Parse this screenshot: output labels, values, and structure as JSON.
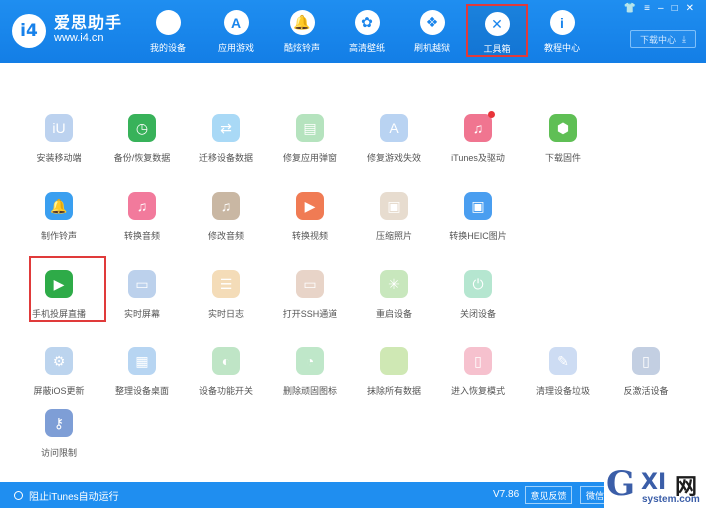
{
  "app": {
    "logo_mark": "i4",
    "name": "爱思助手",
    "url": "www.i4.cn"
  },
  "nav": [
    {
      "label": "我的设备",
      "icon": "apple-icon",
      "glyph": ""
    },
    {
      "label": "应用游戏",
      "icon": "app-store-icon",
      "glyph": "A"
    },
    {
      "label": "酷炫铃声",
      "icon": "bell-icon",
      "glyph": "🔔"
    },
    {
      "label": "高清壁纸",
      "icon": "flower-icon",
      "glyph": "✿"
    },
    {
      "label": "刷机越狱",
      "icon": "dropbox-icon",
      "glyph": "❖"
    },
    {
      "label": "工具箱",
      "icon": "tools-icon",
      "glyph": "✕",
      "active": true
    },
    {
      "label": "教程中心",
      "icon": "info-icon",
      "glyph": "i"
    }
  ],
  "window_controls": [
    "👕",
    "≡",
    "–",
    "□",
    "✕"
  ],
  "download_center": {
    "label": "下载中心",
    "icon": "download-icon",
    "glyph": "⤓"
  },
  "tools": [
    [
      {
        "label": "安装移动端",
        "icon": "i4-app-icon",
        "glyph": "iU",
        "color": "#bcd2ef"
      },
      {
        "label": "备份/恢复数据",
        "icon": "backup-clock-icon",
        "glyph": "◷",
        "color": "#38b25a"
      },
      {
        "label": "迁移设备数据",
        "icon": "migrate-icon",
        "glyph": "⇄",
        "color": "#a9d9f6"
      },
      {
        "label": "修复应用弹窗",
        "icon": "repair-popup-icon",
        "glyph": "▤",
        "color": "#b5e3be"
      },
      {
        "label": "修复游戏失效",
        "icon": "repair-game-icon",
        "glyph": "A",
        "color": "#b9d3f2"
      },
      {
        "label": "iTunes及驱动",
        "icon": "itunes-icon",
        "glyph": "♫",
        "color": "#f07590",
        "badge": true
      },
      {
        "label": "下载固件",
        "icon": "firmware-box-icon",
        "glyph": "⬢",
        "color": "#5fbf55"
      }
    ],
    [
      {
        "label": "制作铃声",
        "icon": "ringtone-bell-icon",
        "glyph": "🔔",
        "color": "#3a9ff0"
      },
      {
        "label": "转换音频",
        "icon": "audio-convert-icon",
        "glyph": "♫",
        "color": "#f27a9c"
      },
      {
        "label": "修改音频",
        "icon": "audio-edit-icon",
        "glyph": "♫",
        "color": "#c9b7a3"
      },
      {
        "label": "转换视频",
        "icon": "video-convert-icon",
        "glyph": "▶",
        "color": "#f07b54"
      },
      {
        "label": "压缩照片",
        "icon": "compress-photo-icon",
        "glyph": "▣",
        "color": "#e7dccf"
      },
      {
        "label": "转换HEIC图片",
        "icon": "heic-convert-icon",
        "glyph": "▣",
        "color": "#4a9ef0"
      }
    ],
    [
      {
        "label": "手机投屏直播",
        "icon": "screen-mirror-icon",
        "glyph": "▶",
        "color": "#2eab48"
      },
      {
        "label": "实时屏幕",
        "icon": "realtime-screen-icon",
        "glyph": "▭",
        "color": "#bcd1ec"
      },
      {
        "label": "实时日志",
        "icon": "realtime-log-icon",
        "glyph": "☰",
        "color": "#f4dcb8"
      },
      {
        "label": "打开SSH通道",
        "icon": "ssh-terminal-icon",
        "glyph": "▭",
        "color": "#e8d4c8"
      },
      {
        "label": "重启设备",
        "icon": "restart-icon",
        "glyph": "✳",
        "color": "#c8e7bd"
      },
      {
        "label": "关闭设备",
        "icon": "power-icon",
        "glyph": "⏻",
        "color": "#b5e6d0"
      }
    ],
    [
      {
        "label": "屏蔽iOS更新",
        "icon": "block-update-icon",
        "glyph": "⚙",
        "color": "#bcd4ee"
      },
      {
        "label": "整理设备桌面",
        "icon": "desktop-grid-icon",
        "glyph": "▦",
        "color": "#b7d5f2"
      },
      {
        "label": "设备功能开关",
        "icon": "toggle-icon",
        "glyph": "◐",
        "color": "#bfe5c6"
      },
      {
        "label": "删除顽固图标",
        "icon": "delete-icon-icon",
        "glyph": "◔",
        "color": "#bfe7c9"
      },
      {
        "label": "抹除所有数据",
        "icon": "erase-apple-icon",
        "glyph": "",
        "color": "#cfe8b4"
      },
      {
        "label": "进入恢复模式",
        "icon": "recovery-mode-icon",
        "glyph": "▯",
        "color": "#f6c1ce"
      },
      {
        "label": "清理设备垃圾",
        "icon": "clean-broom-icon",
        "glyph": "✎",
        "color": "#cddcf3"
      },
      {
        "label": "反激活设备",
        "icon": "deactivate-icon",
        "glyph": "▯",
        "color": "#c3cfe2"
      }
    ],
    [
      {
        "label": "访问限制",
        "icon": "restriction-key-icon",
        "glyph": "⚷",
        "color": "#7e9ed6"
      }
    ]
  ],
  "status": {
    "autorun_label": "阻止iTunes自动运行",
    "version": "V7.86",
    "feedback_label": "意见反馈",
    "wechat_label": "微信公众号"
  },
  "watermark": {
    "g": "G",
    "xi": "XI",
    "net": "网",
    "url": "system.com"
  }
}
